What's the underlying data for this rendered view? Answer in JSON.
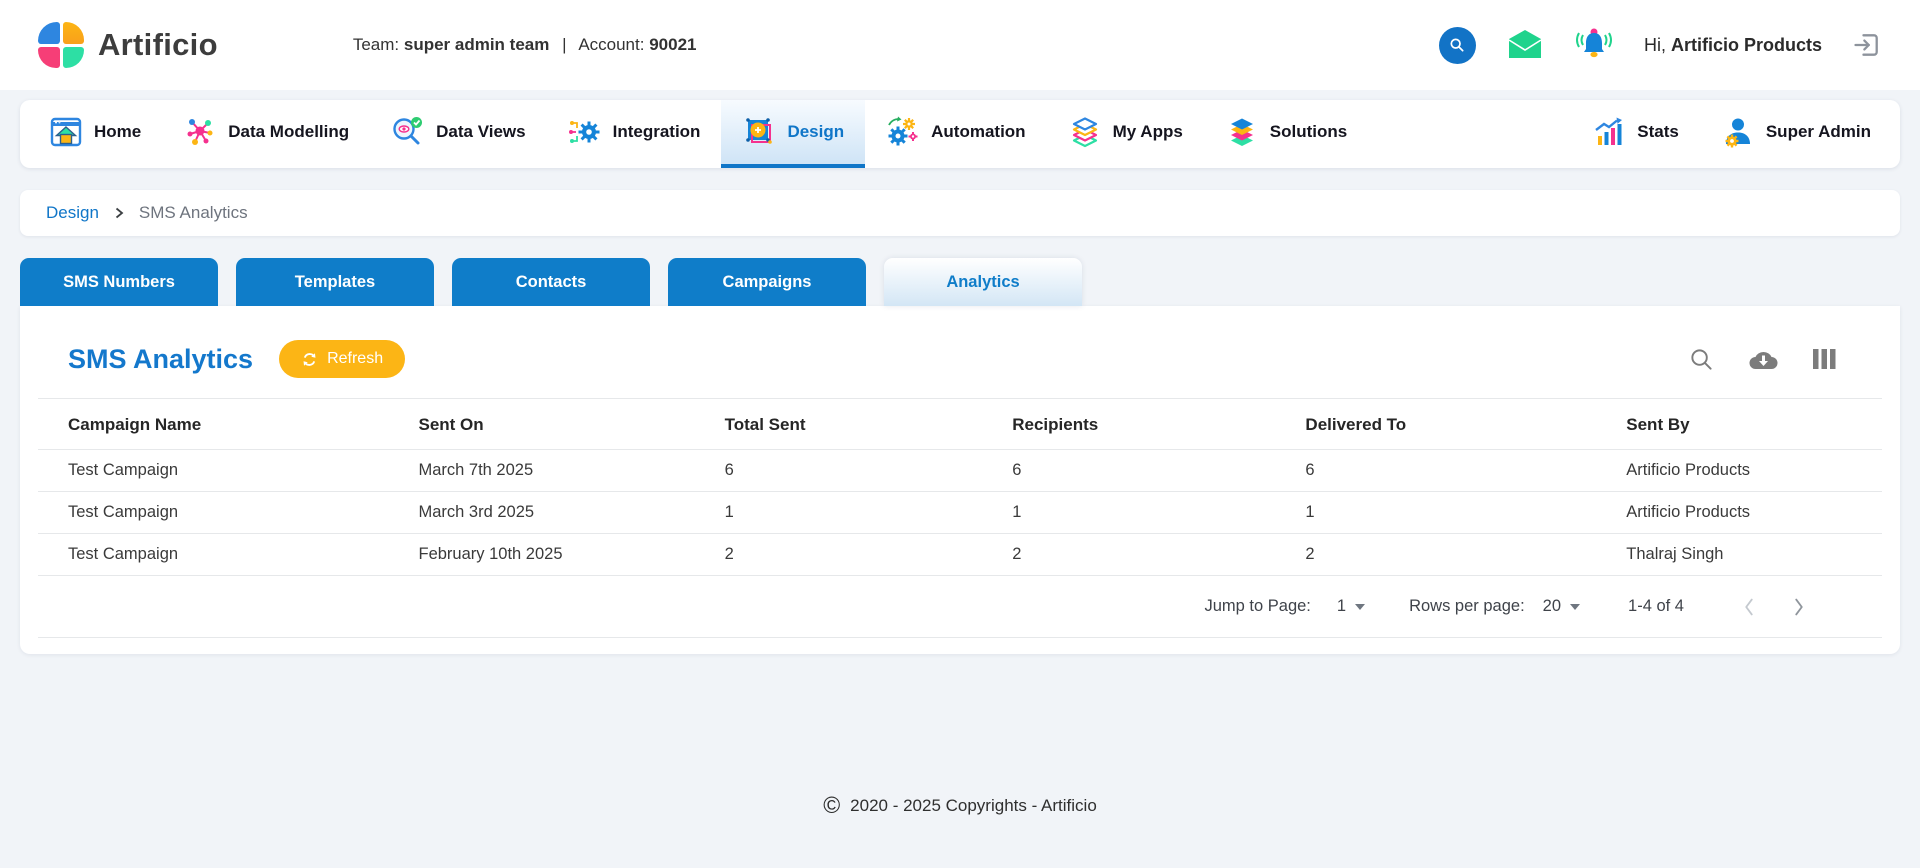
{
  "header": {
    "brand": "Artificio",
    "team_label": "Team:",
    "team_name": "super admin team",
    "separator": "|",
    "account_label": "Account:",
    "account_number": "90021",
    "greeting_prefix": "Hi,",
    "greeting_name": "Artificio Products"
  },
  "nav": {
    "items": [
      {
        "label": "Home"
      },
      {
        "label": "Data Modelling"
      },
      {
        "label": "Data Views"
      },
      {
        "label": "Integration"
      },
      {
        "label": "Design",
        "active": true
      },
      {
        "label": "Automation"
      },
      {
        "label": "My Apps"
      },
      {
        "label": "Solutions"
      }
    ],
    "right_items": [
      {
        "label": "Stats"
      },
      {
        "label": "Super Admin"
      }
    ]
  },
  "breadcrumb": {
    "parent": "Design",
    "chevron": "›",
    "current": "SMS Analytics"
  },
  "tabs": [
    {
      "label": "SMS Numbers"
    },
    {
      "label": "Templates"
    },
    {
      "label": "Contacts"
    },
    {
      "label": "Campaigns"
    },
    {
      "label": "Analytics",
      "active": true
    }
  ],
  "analytics": {
    "title": "SMS Analytics",
    "refresh_label": "Refresh",
    "table": {
      "columns": [
        "Campaign Name",
        "Sent On",
        "Total Sent",
        "Recipients",
        "Delivered To",
        "Sent By"
      ],
      "rows": [
        [
          "Test Campaign",
          "March 7th 2025",
          "6",
          "6",
          "6",
          "Artificio Products"
        ],
        [
          "Test Campaign",
          "March 3rd 2025",
          "1",
          "1",
          "1",
          "Artificio Products"
        ],
        [
          "Test Campaign",
          "February 10th 2025",
          "2",
          "2",
          "2",
          "Thalraj Singh"
        ]
      ]
    },
    "pagination": {
      "jump_label": "Jump to Page:",
      "page_value": "1",
      "rows_label": "Rows per page:",
      "rows_value": "20",
      "range_text": "1-4 of 4"
    }
  },
  "footer": {
    "copyright_symbol": "©",
    "text": "2020 - 2025 Copyrights - Artificio"
  },
  "icons": {
    "header": [
      "search-icon",
      "mail-icon",
      "notifications-bell-icon",
      "logout-icon"
    ],
    "toolbar": [
      "search-icon",
      "cloud-download-icon",
      "columns-icon",
      "refresh-icon"
    ],
    "pagination": [
      "chevron-left-icon",
      "chevron-right-icon"
    ]
  },
  "colors": {
    "primary_blue": "#0f7dc9",
    "nav_active_blue": "#1076c8",
    "title_blue": "#1478cc",
    "accent_yellow": "#fcb515",
    "logo_blue": "#2e86e0",
    "logo_yellow": "#fcb514",
    "logo_pink": "#f63e77",
    "logo_green": "#2ddfa4",
    "mail_green": "#1fd38c",
    "page_background": "#f1f4f8"
  }
}
